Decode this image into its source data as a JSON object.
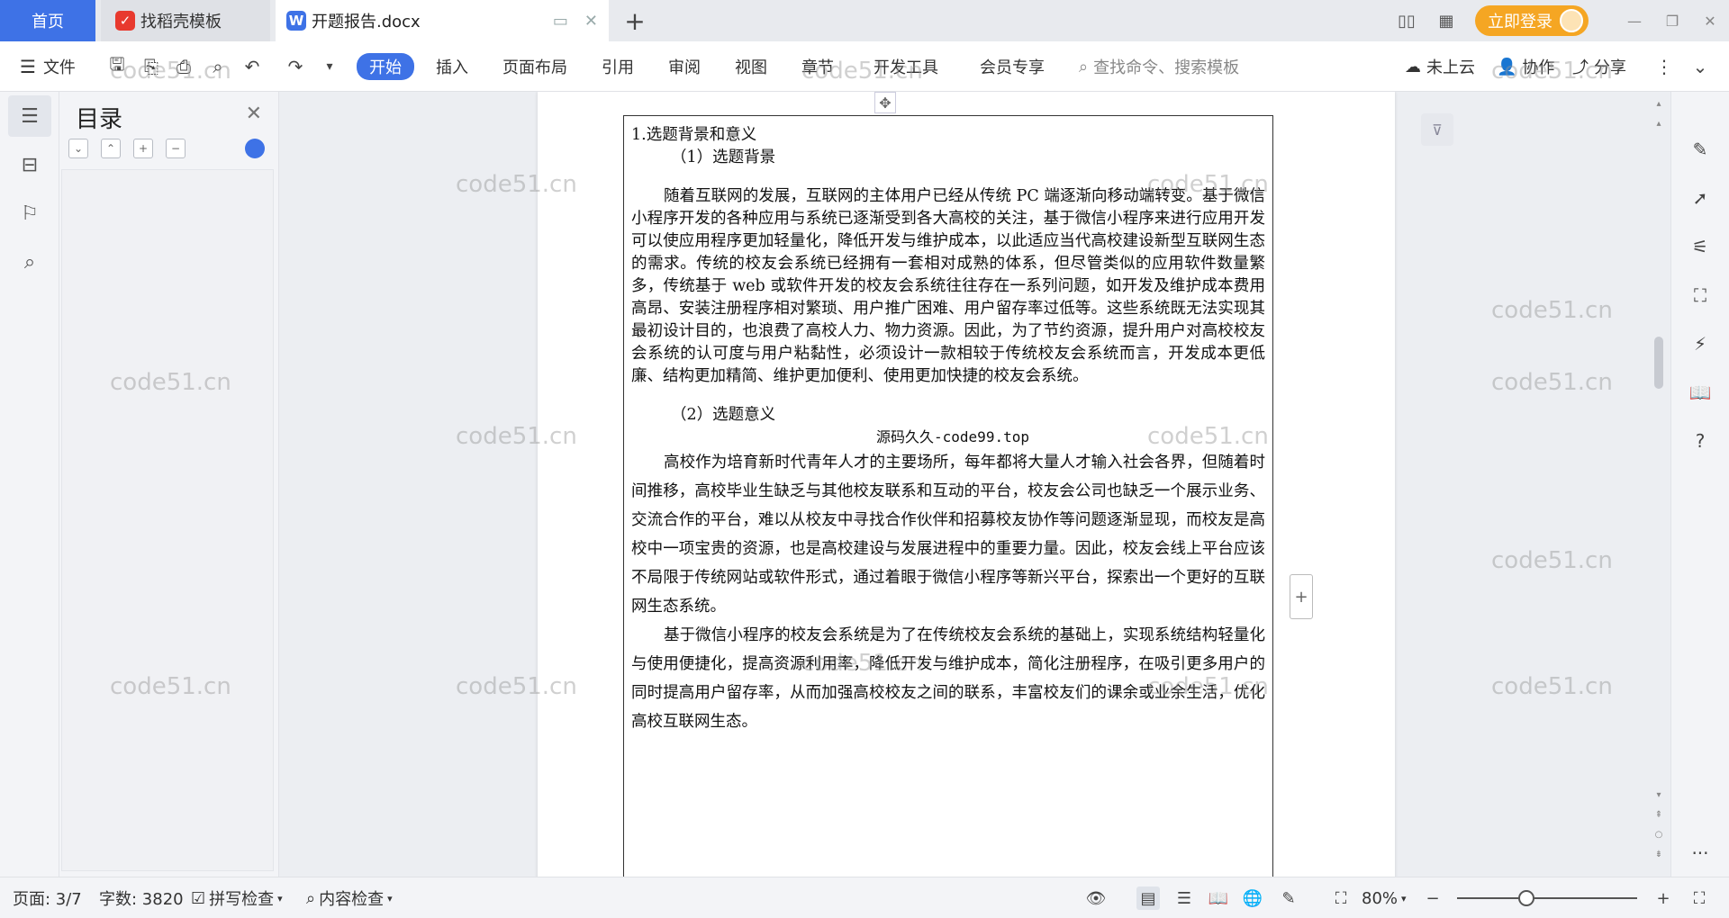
{
  "titlebar": {
    "tabs": [
      {
        "label": "首页"
      },
      {
        "label": "找稻壳模板"
      },
      {
        "label": "开题报告.docx"
      }
    ],
    "login_label": "立即登录"
  },
  "menubar": {
    "file_label": "文件",
    "tabs": [
      "开始",
      "插入",
      "页面布局",
      "引用",
      "审阅",
      "视图",
      "章节",
      "开发工具",
      "会员专享"
    ],
    "active_tab": "开始",
    "search_placeholder": "查找命令、搜索模板",
    "cloud_label": "未上云",
    "collab_label": "协作",
    "share_label": "分享"
  },
  "toc": {
    "title": "目录"
  },
  "document": {
    "heading1": "1.选题背景和意义",
    "sub1": "（1）选题背景",
    "para1": "随着互联网的发展，互联网的主体用户已经从传统 PC 端逐渐向移动端转变。基于微信小程序开发的各种应用与系统已逐渐受到各大高校的关注，基于微信小程序来进行应用开发可以使应用程序更加轻量化，降低开发与维护成本，以此适应当代高校建设新型互联网生态的需求。传统的校友会系统已经拥有一套相对成熟的体系，但尽管类似的应用软件数量繁多，传统基于 web 或软件开发的校友会系统往往存在一系列问题，如开发及维护成本费用高昂、安装注册程序相对繁琐、用户推广困难、用户留存率过低等。这些系统既无法实现其最初设计目的，也浪费了高校人力、物力资源。因此，为了节约资源，提升用户对高校校友会系统的认可度与用户粘黏性，必须设计一款相较于传统校友会系统而言，开发成本更低廉、结构更加精简、维护更加便利、使用更加快捷的校友会系统。",
    "sub2": "（2）选题意义",
    "source_label": "源码久久-code99.top",
    "para2": "高校作为培育新时代青年人才的主要场所，每年都将大量人才输入社会各界，但随着时间推移，高校毕业生缺乏与其他校友联系和互动的平台，校友会公司也缺乏一个展示业务、交流合作的平台，难以从校友中寻找合作伙伴和招募校友协作等问题逐渐显现，而校友是高校中一项宝贵的资源，也是高校建设与发展进程中的重要力量。因此，校友会线上平台应该不局限于传统网站或软件形式，通过着眼于微信小程序等新兴平台，探索出一个更好的互联网生态系统。",
    "para3": "基于微信小程序的校友会系统是为了在传统校友会系统的基础上，实现系统结构轻量化与使用便捷化，提高资源利用率，降低开发与维护成本，简化注册程序，在吸引更多用户的同时提高用户留存率，从而加强高校校友之间的联系，丰富校友们的课余或业余生活，优化高校互联网生态。"
  },
  "watermark": "code51.cn",
  "statusbar": {
    "page_label": "页面: 3/7",
    "wordcount_label": "字数: 3820",
    "spellcheck_label": "拼写检查",
    "contentcheck_label": "内容检查",
    "zoom_label": "80%"
  },
  "colors": {
    "accent": "#3e72e6",
    "login": "#f5a623"
  }
}
